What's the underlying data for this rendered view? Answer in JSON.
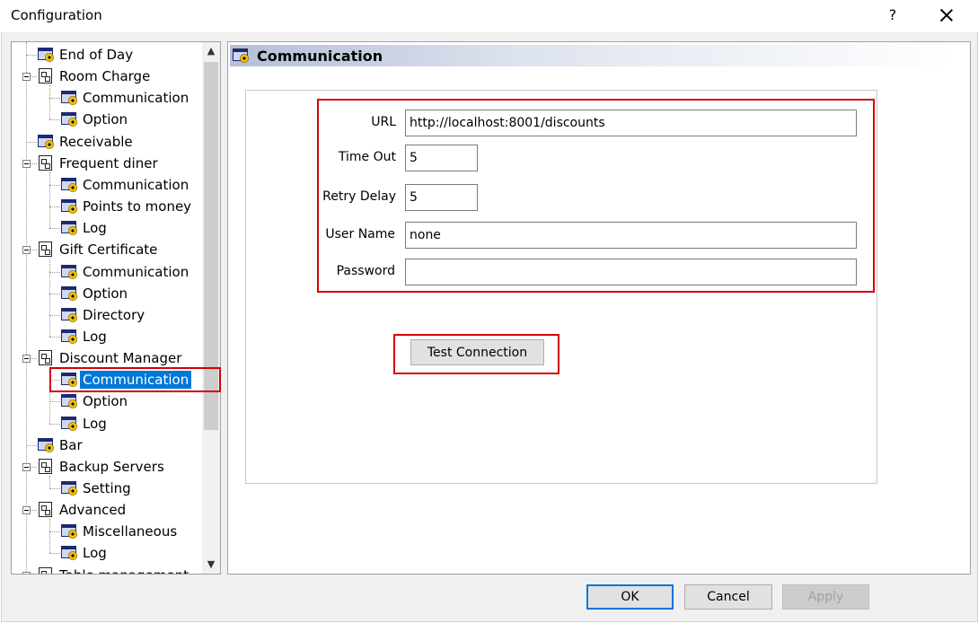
{
  "window": {
    "title": "Configuration",
    "help_label": "?"
  },
  "tree": {
    "items": [
      {
        "label": "End of Day",
        "level": 0,
        "icon": "gear-window-icon",
        "expandable": false
      },
      {
        "label": "Room Charge",
        "level": 0,
        "icon": "folder-tree-icon",
        "expandable": true
      },
      {
        "label": "Communication",
        "level": 1,
        "icon": "gear-window-icon",
        "expandable": false
      },
      {
        "label": "Option",
        "level": 1,
        "icon": "gear-window-icon",
        "expandable": false
      },
      {
        "label": "Receivable",
        "level": 0,
        "icon": "gear-window-icon",
        "expandable": false
      },
      {
        "label": "Frequent diner",
        "level": 0,
        "icon": "folder-tree-icon",
        "expandable": true
      },
      {
        "label": "Communication",
        "level": 1,
        "icon": "gear-window-icon",
        "expandable": false
      },
      {
        "label": "Points to money",
        "level": 1,
        "icon": "gear-window-icon",
        "expandable": false
      },
      {
        "label": "Log",
        "level": 1,
        "icon": "gear-window-icon",
        "expandable": false
      },
      {
        "label": "Gift Certificate",
        "level": 0,
        "icon": "folder-tree-icon",
        "expandable": true
      },
      {
        "label": "Communication",
        "level": 1,
        "icon": "gear-window-icon",
        "expandable": false
      },
      {
        "label": "Option",
        "level": 1,
        "icon": "gear-window-icon",
        "expandable": false
      },
      {
        "label": "Directory",
        "level": 1,
        "icon": "gear-window-icon",
        "expandable": false
      },
      {
        "label": "Log",
        "level": 1,
        "icon": "gear-window-icon",
        "expandable": false
      },
      {
        "label": "Discount Manager",
        "level": 0,
        "icon": "folder-tree-icon",
        "expandable": true
      },
      {
        "label": "Communication",
        "level": 1,
        "icon": "gear-window-icon",
        "expandable": false,
        "selected": true
      },
      {
        "label": "Option",
        "level": 1,
        "icon": "gear-window-icon",
        "expandable": false
      },
      {
        "label": "Log",
        "level": 1,
        "icon": "gear-window-icon",
        "expandable": false
      },
      {
        "label": "Bar",
        "level": 0,
        "icon": "gear-window-icon",
        "expandable": false
      },
      {
        "label": "Backup Servers",
        "level": 0,
        "icon": "folder-tree-icon",
        "expandable": true
      },
      {
        "label": "Setting",
        "level": 1,
        "icon": "gear-window-icon",
        "expandable": false
      },
      {
        "label": "Advanced",
        "level": 0,
        "icon": "folder-tree-icon",
        "expandable": true
      },
      {
        "label": "Miscellaneous",
        "level": 1,
        "icon": "gear-window-icon",
        "expandable": false
      },
      {
        "label": "Log",
        "level": 1,
        "icon": "gear-window-icon",
        "expandable": false
      },
      {
        "label": "Table management",
        "level": 0,
        "icon": "folder-tree-icon",
        "expandable": true
      }
    ]
  },
  "panel": {
    "title": "Communication",
    "icon": "gear-window-icon"
  },
  "form": {
    "url_label": "URL",
    "url_value": "http://localhost:8001/discounts",
    "timeout_label": "Time Out",
    "timeout_value": "5",
    "retry_label": "Retry Delay",
    "retry_value": "5",
    "username_label": "User Name",
    "username_value": "none",
    "password_label": "Password",
    "password_value": "",
    "test_button": "Test Connection"
  },
  "footer": {
    "ok": "OK",
    "cancel": "Cancel",
    "apply": "Apply"
  },
  "colors": {
    "selection": "#0078d7",
    "annotation": "#d50000"
  }
}
